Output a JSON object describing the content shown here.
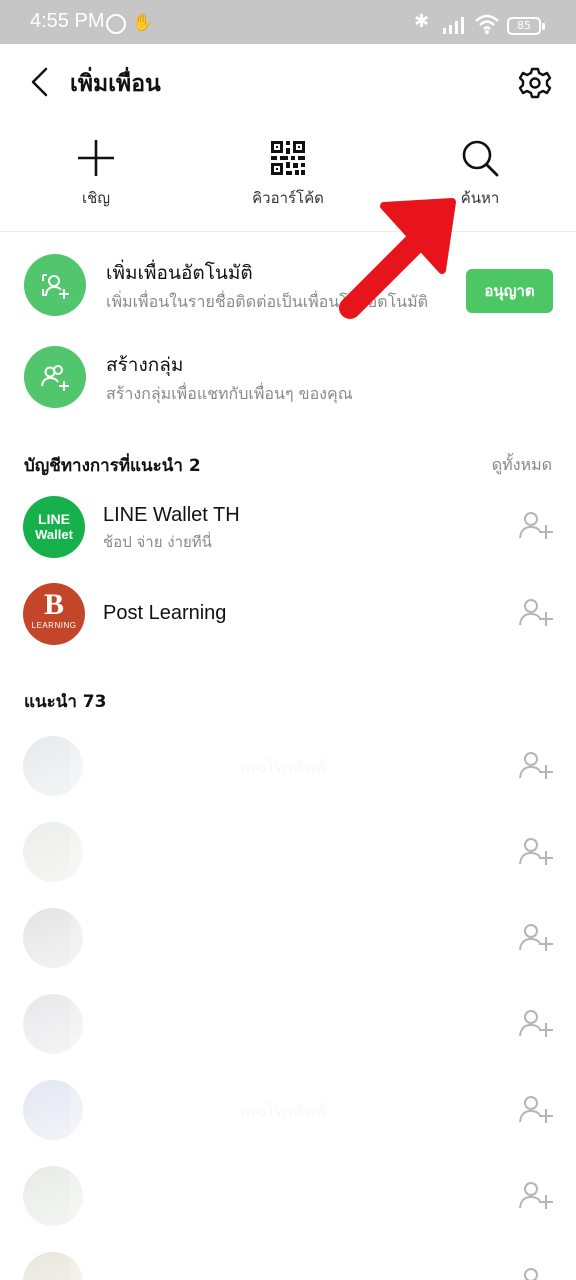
{
  "status_bar": {
    "time": "4:55 PM",
    "battery": "85",
    "icons": [
      "alarm-icon",
      "hand-icon",
      "bluetooth-icon",
      "signal-icon",
      "wifi-icon",
      "battery-icon"
    ]
  },
  "header": {
    "title": "เพิ่มเพื่อน",
    "back_icon": "chevron-left-icon",
    "settings_icon": "gear-icon"
  },
  "actions": [
    {
      "label": "เชิญ",
      "icon": "plus-icon"
    },
    {
      "label": "คิวอาร์โค้ด",
      "icon": "qr-code-icon"
    },
    {
      "label": "ค้นหา",
      "icon": "search-icon"
    }
  ],
  "options": {
    "auto_add": {
      "title": "เพิ่มเพื่อนอัตโนมัติ",
      "subtitle": "เพิ่มเพื่อนในรายชื่อติดต่อเป็นเพื่อนโดยอัตโนมัติ",
      "button": "อนุญาต"
    },
    "create_group": {
      "title": "สร้างกลุ่ม",
      "subtitle": "สร้างกลุ่มเพื่อแชทกับเพื่อนๆ ของคุณ"
    }
  },
  "official_section": {
    "title": "บัญชีทางการที่แนะนำ 2",
    "see_all": "ดูทั้งหมด",
    "accounts": [
      {
        "name": "LINE Wallet TH",
        "subtitle": "ช้อป จ่าย ง่ายทีนี่",
        "avatar_line1": "LINE",
        "avatar_line2": "Wallet"
      },
      {
        "name": "Post Learning",
        "subtitle": "",
        "avatar_letter": "B",
        "avatar_caption": "LEARNING"
      }
    ]
  },
  "recommended_section": {
    "title": "แนะนำ 73",
    "items": [
      {
        "text": "เลขโทรศัพท์"
      },
      {
        "text": ""
      },
      {
        "text": ""
      },
      {
        "text": ""
      },
      {
        "text": "เลขโทรศัพท์"
      },
      {
        "text": ""
      },
      {
        "text": ""
      }
    ]
  },
  "colors": {
    "line_green": "#4cc764",
    "status_bar": "#c6c6c6",
    "annotation_arrow": "#e8141c"
  }
}
